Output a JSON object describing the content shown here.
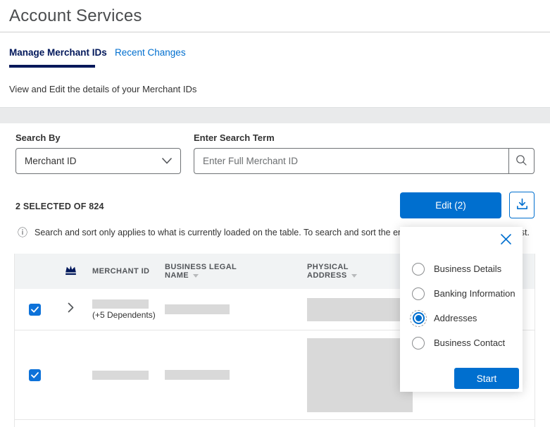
{
  "header": {
    "title": "Account Services"
  },
  "tabs": {
    "manage": "Manage Merchant IDs",
    "recent": "Recent Changes"
  },
  "subtitle": "View and Edit the details of your Merchant IDs",
  "search": {
    "by_label": "Search By",
    "by_value": "Merchant ID",
    "term_label": "Enter Search Term",
    "term_placeholder": "Enter Full Merchant ID"
  },
  "toolbar": {
    "selection_summary": "2 SELECTED OF 824",
    "edit_label": "Edit (2)"
  },
  "info_note": "Search and sort only applies to what is currently loaded on the table. To search and sort the entire table, load the entire list first.",
  "table": {
    "col_merchant_id": "MERCHANT ID",
    "col_business_legal_line1": "BUSINESS LEGAL",
    "col_business_legal_line2": "NAME",
    "col_physical_line1": "PHYSICAL",
    "col_physical_line2": "ADDRESS",
    "row1_dependents": "(+5 Dependents)"
  },
  "popup": {
    "options": [
      {
        "label": "Business Details",
        "selected": false
      },
      {
        "label": "Banking Information",
        "selected": false
      },
      {
        "label": "Addresses",
        "selected": true
      },
      {
        "label": "Business Contact",
        "selected": false
      }
    ],
    "start_label": "Start"
  },
  "icons": {
    "info": "ⓘ"
  },
  "colors": {
    "brand_blue": "#006fcf",
    "dark_navy": "#00175a",
    "placeholder_gray": "#d9d9d9"
  }
}
